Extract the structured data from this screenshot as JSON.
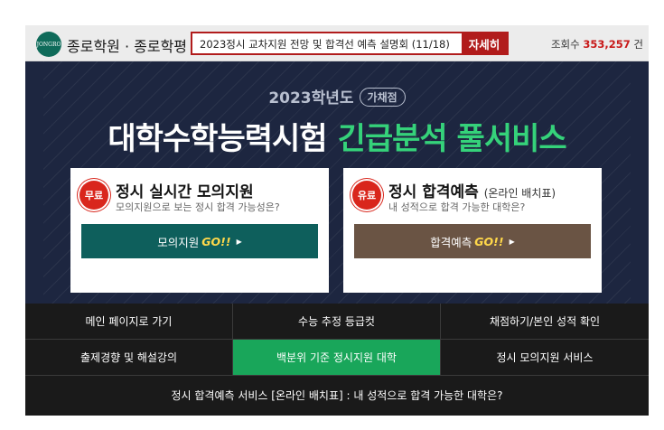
{
  "topbar": {
    "logo_text": "JONGRO",
    "brand": "종로학원 · 종로학평",
    "notice_text": "2023정시 교차지원 전망 및 합격선 예측 설명회 (11/18)",
    "notice_button": "자세히",
    "visits_label": "조회수",
    "visits_count": "353,257",
    "visits_unit": "건"
  },
  "banner": {
    "year": "2023학년도",
    "year_tag": "가채점",
    "headline_white": "대학수학능력시험",
    "headline_green": "긴급분석 풀서비스"
  },
  "cards": [
    {
      "badge": "무료",
      "title": "정시 실시간 모의지원",
      "subtitle": "",
      "desc": "모의지원으로 보는 정시 합격 가능성은?",
      "button_text": "모의지원",
      "button_go": "GO!!"
    },
    {
      "badge": "유료",
      "title": "정시 합격예측",
      "subtitle": "(온라인 배치표)",
      "desc": "내 성적으로 합격 가능한 대학은?",
      "button_text": "합격예측",
      "button_go": "GO!!"
    }
  ],
  "nav": {
    "row1": [
      "메인 페이지로 가기",
      "수능 추정 등급컷",
      "채점하기/본인 성적 확인"
    ],
    "row2": [
      "출제경향 및 해설강의",
      "백분위 기준 정시지원 대학",
      "정시 모의지원 서비스"
    ],
    "full": "정시 합격예측 서비스 [온라인 배치표] : 내 성적으로 합격 가능한 대학은?"
  },
  "colors": {
    "accent_red": "#b11c1c",
    "banner_bg": "#1d2640",
    "headline_green": "#35d27a",
    "nav_active": "#19a65a"
  }
}
